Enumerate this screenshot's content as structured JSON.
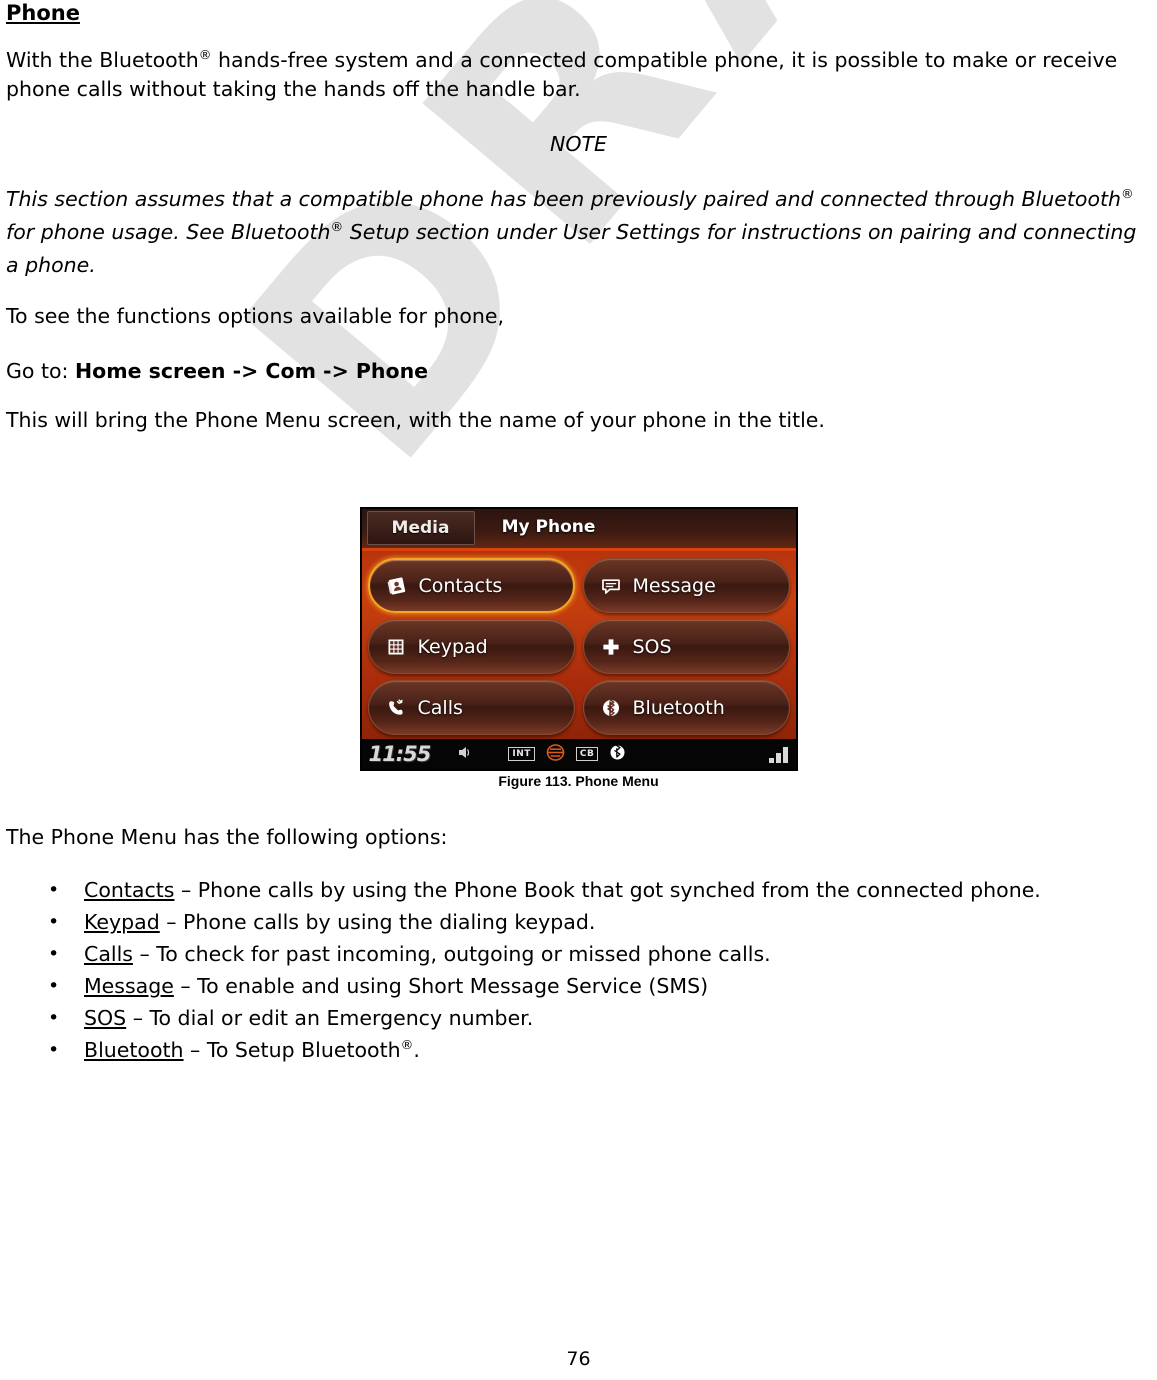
{
  "document": {
    "heading": "Phone",
    "page_number": "76",
    "watermark": "DRAFT",
    "watermark_color": "#e2e2e2"
  },
  "intro": {
    "text_before_reg": "With the Bluetooth",
    "reg_mark": "®",
    "text_after_reg": " hands-free system and a connected compatible phone, it is possible to make or receive phone calls without taking the hands off the handle bar."
  },
  "note": {
    "title": "NOTE",
    "part1": "This section assumes that a compatible phone has been previously paired and connected through Bluetooth",
    "part2": " for phone usage. See Bluetooth",
    "part3": " Setup section under User Settings for instructions on pairing and connecting a phone."
  },
  "instructions": {
    "see_functions": "To see the functions options available for phone,",
    "goto_label": "Go to:",
    "goto_path": "Home screen -> Com -> Phone",
    "result": "This will bring the Phone Menu screen, with the name of your phone in the title."
  },
  "figure": {
    "caption": "Figure 113. Phone Menu",
    "device_screen": {
      "tab_label": "Media",
      "title": "My Phone",
      "buttons": [
        {
          "label": "Contacts",
          "icon": "contacts-book-icon",
          "selected": true
        },
        {
          "label": "Message",
          "icon": "message-bubble-icon",
          "selected": false
        },
        {
          "label": "Keypad",
          "icon": "keypad-grid-icon",
          "selected": false
        },
        {
          "label": "SOS",
          "icon": "plus-cross-icon",
          "selected": false
        },
        {
          "label": "Calls",
          "icon": "phone-handset-icon",
          "selected": false
        },
        {
          "label": "Bluetooth",
          "icon": "bluetooth-icon",
          "selected": false
        }
      ],
      "status_bar": {
        "clock": "11:55",
        "speaker_icon": "speaker-icon",
        "int_badge": "INT",
        "shield_icon": "harley-shield-icon",
        "cb_badge": "CB",
        "bluetooth_icon": "bluetooth-icon",
        "signal_icon": "signal-bars-icon"
      }
    }
  },
  "options": {
    "intro": "The Phone Menu has the following options:",
    "items": [
      {
        "term": "Contacts",
        "desc": " – Phone calls by using the Phone Book that got synched from the connected phone."
      },
      {
        "term": "Keypad",
        "desc": " – Phone calls by using the dialing keypad."
      },
      {
        "term": "Calls",
        "desc": " – To check for past incoming, outgoing or missed phone calls."
      },
      {
        "term": "Message",
        "desc": " – To enable and using Short Message Service (SMS)"
      },
      {
        "term": "SOS",
        "desc": " – To dial or edit an Emergency number."
      },
      {
        "term": "Bluetooth",
        "desc": " – To Setup Bluetooth"
      },
      {
        "term": "",
        "desc": ""
      }
    ],
    "bluetooth_suffix": "."
  }
}
